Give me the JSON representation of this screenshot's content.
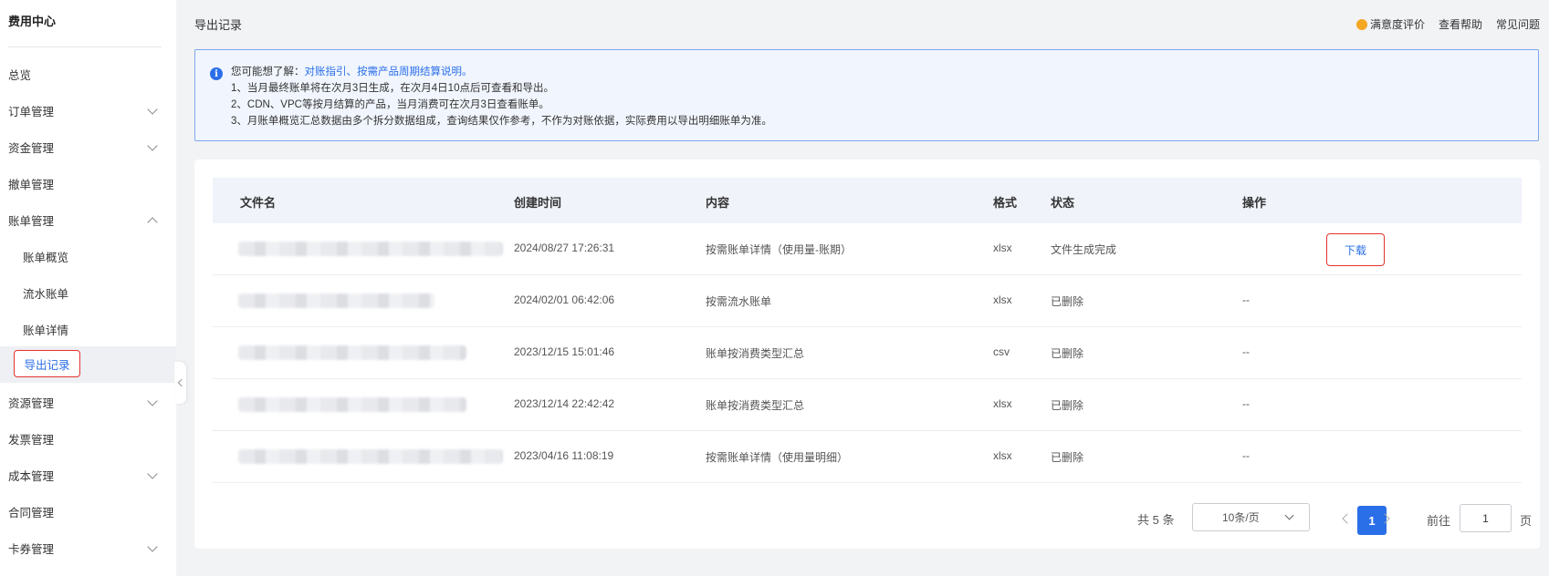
{
  "sidebar": {
    "title": "费用中心",
    "items": [
      {
        "label": "总览"
      },
      {
        "label": "订单管理"
      },
      {
        "label": "资金管理"
      },
      {
        "label": "撤单管理"
      },
      {
        "label": "账单管理"
      },
      {
        "label": "账单概览"
      },
      {
        "label": "流水账单"
      },
      {
        "label": "账单详情"
      },
      {
        "label": "导出记录"
      },
      {
        "label": "资源管理"
      },
      {
        "label": "发票管理"
      },
      {
        "label": "成本管理"
      },
      {
        "label": "合同管理"
      },
      {
        "label": "卡券管理"
      }
    ]
  },
  "header": {
    "title": "导出记录",
    "links": {
      "rating": "满意度评价",
      "help": "查看帮助",
      "faq": "常见问题"
    }
  },
  "notice": {
    "prefix": "您可能想了解：",
    "link": "对账指引、按需产品周期结算说明。",
    "lines": [
      "1、当月最终账单将在次月3日生成，在次月4日10点后可查看和导出。",
      "2、CDN、VPC等按月结算的产品，当月消费可在次月3日查看账单。",
      "3、月账单概览汇总数据由多个拆分数据组成，查询结果仅作参考，不作为对账依据，实际费用以导出明细账单为准。"
    ]
  },
  "table": {
    "headers": {
      "filename": "文件名",
      "created": "创建时间",
      "content": "内容",
      "format": "格式",
      "status": "状态",
      "action": "操作"
    },
    "rows": [
      {
        "created": "2024/08/27 17:26:31",
        "content": "按需账单详情（使用量-账期）",
        "format": "xlsx",
        "status": "文件生成完成",
        "action": "下载"
      },
      {
        "created": "2024/02/01 06:42:06",
        "content": "按需流水账单",
        "format": "xlsx",
        "status": "已删除",
        "action": "--"
      },
      {
        "created": "2023/12/15 15:01:46",
        "content": "账单按消费类型汇总",
        "format": "csv",
        "status": "已删除",
        "action": "--"
      },
      {
        "created": "2023/12/14 22:42:42",
        "content": "账单按消费类型汇总",
        "format": "xlsx",
        "status": "已删除",
        "action": "--"
      },
      {
        "created": "2023/04/16 11:08:19",
        "content": "按需账单详情（使用量明细）",
        "format": "xlsx",
        "status": "已删除",
        "action": "--"
      }
    ]
  },
  "pagination": {
    "total": "共 5 条",
    "page_size": "10条/页",
    "current": "1",
    "goto_label": "前往",
    "goto_value": "1",
    "page_unit": "页"
  }
}
